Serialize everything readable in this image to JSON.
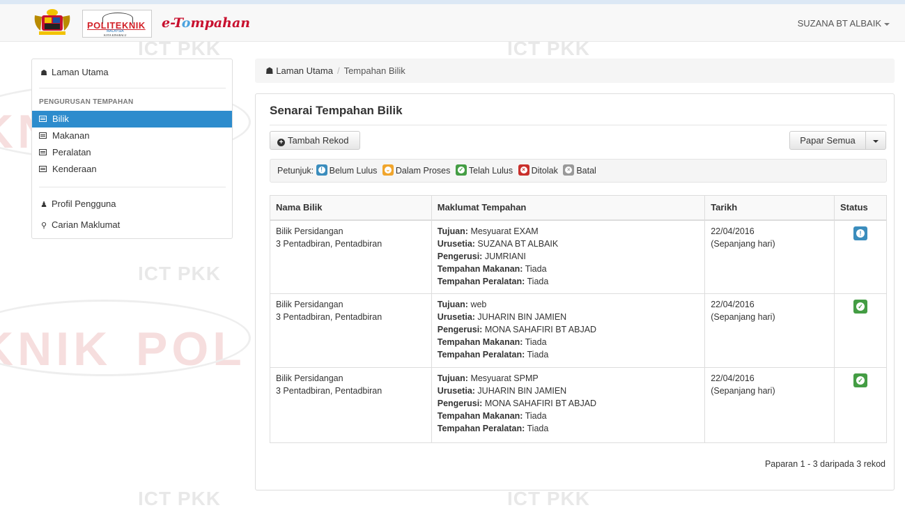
{
  "header": {
    "logo_text": "POLITEKNIK",
    "logo_sub": "MALAYSIA",
    "logo_campus": "KOTA KINABALU",
    "brand_prefix": "e-T",
    "brand_o": "o",
    "brand_suffix": "mpahan",
    "user": "SUZANA BT ALBAIK"
  },
  "watermarks": {
    "ict": "ICT PKK",
    "big1": "KNIK",
    "big2": "POL"
  },
  "sidebar": {
    "home": "Laman Utama",
    "section_header": "PENGURUSAN TEMPAHAN",
    "items": [
      {
        "label": "Bilik",
        "active": true
      },
      {
        "label": "Makanan",
        "active": false
      },
      {
        "label": "Peralatan",
        "active": false
      },
      {
        "label": "Kenderaan",
        "active": false
      }
    ],
    "profile": "Profil Pengguna",
    "search": "Carian Maklumat"
  },
  "breadcrumb": {
    "home": "Laman Utama",
    "current": "Tempahan Bilik"
  },
  "panel": {
    "title": "Senarai Tempahan Bilik",
    "add_button": "Tambah Rekod",
    "show_button": "Papar Semua",
    "legend_label": "Petunjuk:",
    "legend": [
      "Belum Lulus",
      "Dalam Proses",
      "Telah Lulus",
      "Ditolak",
      "Batal"
    ],
    "footer": "Paparan 1 - 3 daripada 3 rekod"
  },
  "table": {
    "headers": [
      "Nama Bilik",
      "Maklumat Tempahan",
      "Tarikh",
      "Status"
    ],
    "field_labels": {
      "tujuan": "Tujuan:",
      "urusetia": "Urusetia:",
      "pengerusi": "Pengerusi:",
      "makanan": "Tempahan Makanan:",
      "peralatan": "Tempahan Peralatan:"
    },
    "rows": [
      {
        "room": "Bilik Persidangan",
        "location": "3 Pentadbiran, Pentadbiran",
        "tujuan": "Mesyuarat EXAM",
        "urusetia": "SUZANA BT ALBAIK",
        "pengerusi": "JUMRIANI",
        "makanan": "Tiada",
        "peralatan": "Tiada",
        "date": "22/04/2016",
        "duration": "(Sepanjang hari)",
        "status": "Belum Lulus"
      },
      {
        "room": "Bilik Persidangan",
        "location": "3 Pentadbiran, Pentadbiran",
        "tujuan": "web",
        "urusetia": "JUHARIN BIN JAMIEN",
        "pengerusi": "MONA SAHAFIRI BT ABJAD",
        "makanan": "Tiada",
        "peralatan": "Tiada",
        "date": "22/04/2016",
        "duration": "(Sepanjang hari)",
        "status": "Telah Lulus"
      },
      {
        "room": "Bilik Persidangan",
        "location": "3 Pentadbiran, Pentadbiran",
        "tujuan": "Mesyuarat SPMP",
        "urusetia": "JUHARIN BIN JAMIEN",
        "pengerusi": "MONA SAHAFIRI BT ABJAD",
        "makanan": "Tiada",
        "peralatan": "Tiada",
        "date": "22/04/2016",
        "duration": "(Sepanjang hari)",
        "status": "Telah Lulus"
      }
    ]
  },
  "colors": {
    "active": "#2d8ccd",
    "belum_lulus": "#3b8dbd",
    "dalam_proses": "#f0a52c",
    "telah_lulus": "#449d44",
    "ditolak": "#c9302c",
    "batal": "#999999",
    "brand": "#c8102e"
  }
}
